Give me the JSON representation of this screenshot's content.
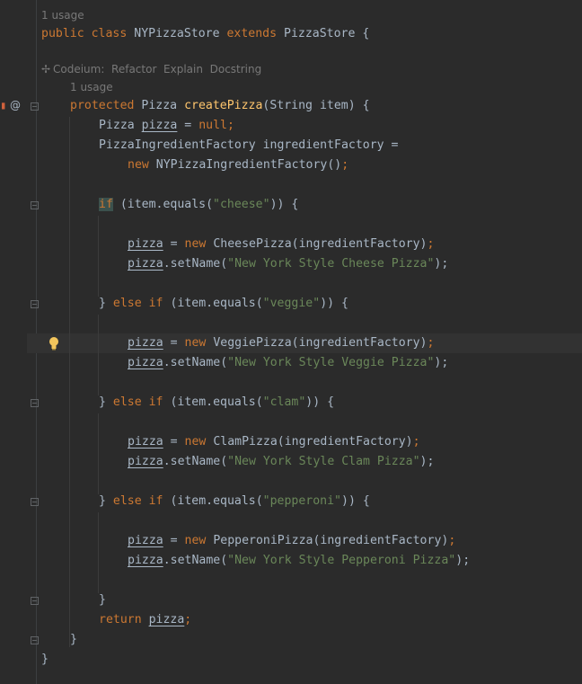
{
  "editor": {
    "usage_class": "1 usage",
    "class_decl": {
      "kw1": "public",
      "kw2": "class",
      "name": "NYPizzaStore",
      "kw3": "extends",
      "parent": "PizzaStore",
      "brace": " {"
    },
    "codeium": {
      "label": "Codeium:",
      "refactor": "Refactor",
      "explain": "Explain",
      "docstring": "Docstring"
    },
    "usage_method": "1 usage",
    "method_decl": {
      "kw": "protected",
      "type": "Pizza",
      "name": "createPizza",
      "params": "(String item) {"
    },
    "line_pizza_null": {
      "type": "Pizza",
      "var": "pizza",
      "eq": " = ",
      "val": "null",
      "semi": ";"
    },
    "line_factory_decl": "PizzaIngredientFactory ingredientFactory =",
    "line_factory_new": {
      "kw": "new",
      "call": "NYPizzaIngredientFactory()",
      "semi": ";"
    },
    "if_cheese": {
      "kw": "if",
      "rest1": " (item.equals(",
      "str": "\"cheese\"",
      "rest2": ")) {"
    },
    "cheese_new": {
      "var": "pizza",
      "eq": " = ",
      "kw": "new",
      "call": "CheesePizza(ingredientFactory)",
      "semi": ";"
    },
    "cheese_set": {
      "var": "pizza",
      "call": ".setName(",
      "str": "\"New York Style Cheese Pizza\"",
      "end": ");"
    },
    "elif_veggie": {
      "brace": "} ",
      "kw1": "else",
      "kw2": "if",
      "rest1": " (item.equals(",
      "str": "\"veggie\"",
      "rest2": ")) {"
    },
    "veggie_new": {
      "var": "pizza",
      "eq": " = ",
      "kw": "new",
      "call": "VeggiePizza(ingredientFactory)",
      "semi": ";"
    },
    "veggie_set": {
      "var": "pizza",
      "call": ".setName(",
      "str": "\"New York Style Veggie Pizza\"",
      "end": ");"
    },
    "elif_clam": {
      "brace": "} ",
      "kw1": "else",
      "kw2": "if",
      "rest1": " (item.equals(",
      "str": "\"clam\"",
      "rest2": ")) {"
    },
    "clam_new": {
      "var": "pizza",
      "eq": " = ",
      "kw": "new",
      "call": "ClamPizza(ingredientFactory)",
      "semi": ";"
    },
    "clam_set": {
      "var": "pizza",
      "call": ".setName(",
      "str": "\"New York Style Clam Pizza\"",
      "end": ");"
    },
    "elif_pepperoni": {
      "brace": "} ",
      "kw1": "else",
      "kw2": "if",
      "rest1": " (item.equals(",
      "str": "\"pepperoni\"",
      "rest2": ")) {"
    },
    "pepperoni_new": {
      "var": "pizza",
      "eq": " = ",
      "kw": "new",
      "call": "PepperoniPizza(ingredientFactory)",
      "semi": ";"
    },
    "pepperoni_set": {
      "var": "pizza",
      "call": ".setName(",
      "str": "\"New York Style Pepperoni Pizza\"",
      "end": ");"
    },
    "close_if": "}",
    "return_line": {
      "kw": "return",
      "var": "pizza",
      "semi": ";"
    },
    "close_method": "}",
    "close_class": "}"
  },
  "gutter": {
    "at_symbol": "@"
  },
  "colors": {
    "background": "#2b2b2b",
    "keyword": "#cc7832",
    "string": "#6a8759",
    "function": "#ffc66d",
    "text": "#a9b7c6"
  }
}
